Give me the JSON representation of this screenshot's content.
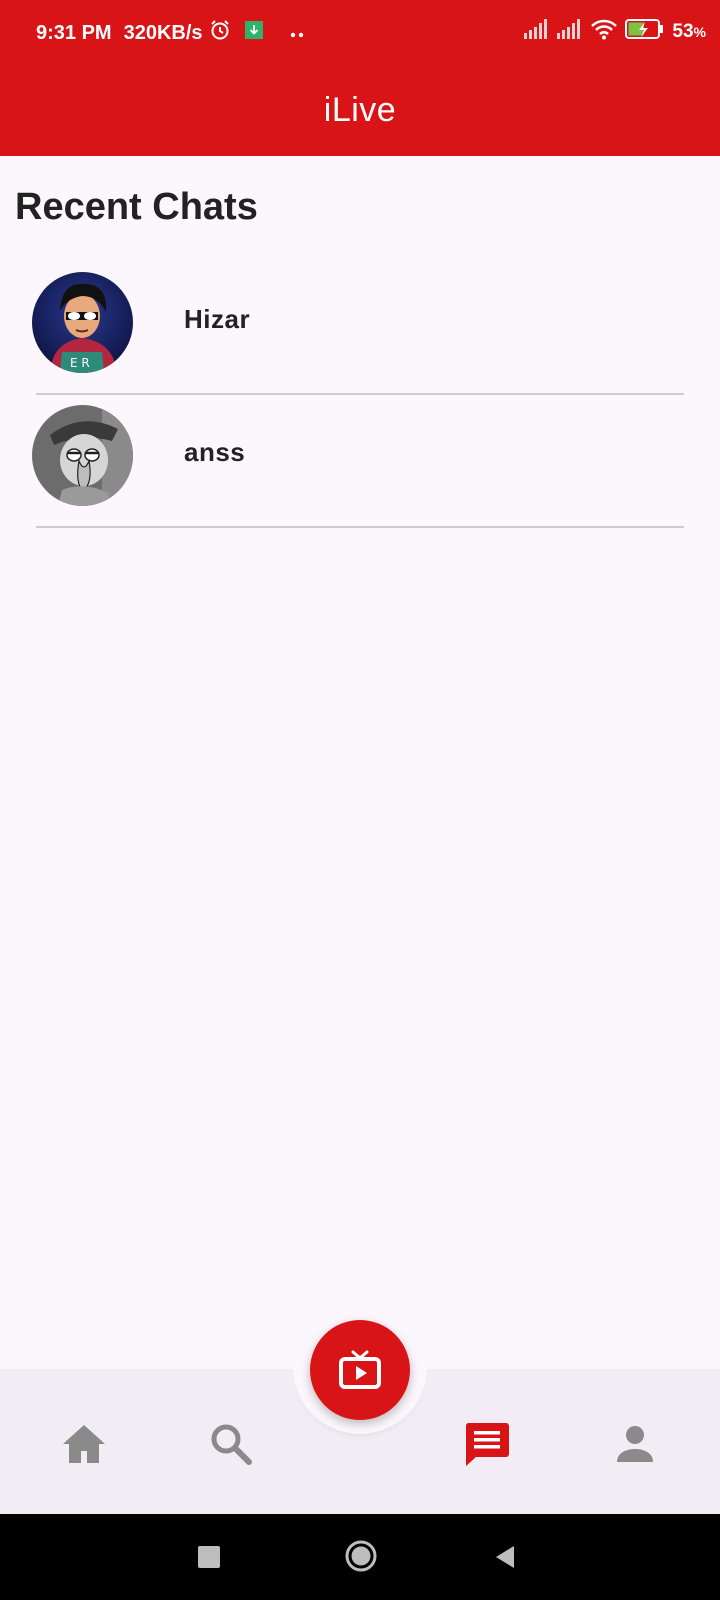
{
  "status_bar": {
    "time": "9:31 PM",
    "speed": "320KB/s",
    "battery": "53",
    "battery_unit": "%",
    "icons": [
      "alarm-icon",
      "download-icon",
      "dots-icon",
      "signal-icon",
      "signal-icon",
      "wifi-icon",
      "battery-charging-icon"
    ]
  },
  "app_bar": {
    "title": "iLive"
  },
  "section": {
    "title": "Recent Chats"
  },
  "chats": [
    {
      "name": "Hizar",
      "avatar": "avatar-hero-icon"
    },
    {
      "name": "anss",
      "avatar": "avatar-squid-icon"
    }
  ],
  "bottom_nav": {
    "items": [
      {
        "icon": "home-icon",
        "active": false
      },
      {
        "icon": "search-icon",
        "active": false
      },
      {
        "icon": "chat-icon",
        "active": true
      },
      {
        "icon": "person-icon",
        "active": false
      }
    ],
    "fab_icon": "live-tv-icon"
  },
  "colors": {
    "primary": "#d91417",
    "background": "#fcf7fc",
    "nav_bg": "#f2ecf4",
    "inactive_icon": "#8a8a8a"
  },
  "system_nav": [
    "recents-icon",
    "home-circle-icon",
    "back-icon"
  ]
}
